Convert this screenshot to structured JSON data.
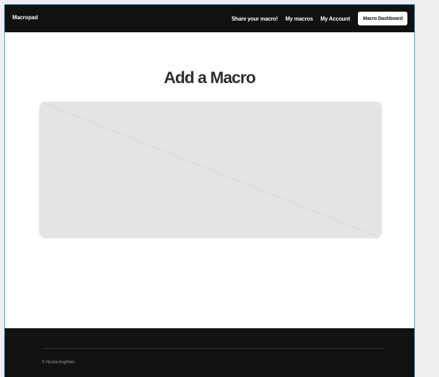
{
  "navbar": {
    "brand": "Macropad",
    "links": [
      {
        "label": "Share your macro!"
      },
      {
        "label": "My macros"
      },
      {
        "label": "My Account"
      }
    ],
    "cta_label": "Macro Dashboard"
  },
  "main": {
    "title": "Add a Macro",
    "image_placeholder": {
      "background": "#e4e4e4",
      "line_color": "#d6d6d6"
    }
  },
  "footer": {
    "copyright": "© Nicola Anghileri."
  },
  "colors": {
    "nav_bg": "#111111",
    "footer_bg": "#111111",
    "title_text": "#2e2e2e",
    "frame_border": "#3aa0e8"
  }
}
